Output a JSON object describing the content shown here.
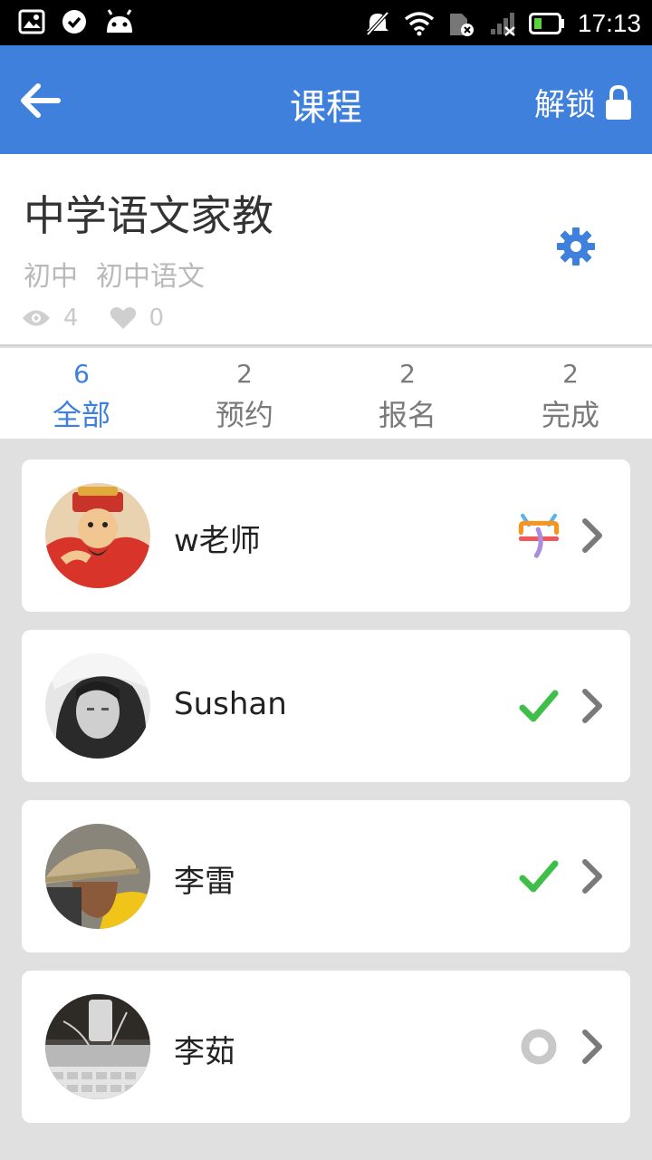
{
  "status_bar": {
    "time": "17:13"
  },
  "app_bar": {
    "title": "课程",
    "unlock_label": "解锁"
  },
  "course": {
    "title": "中学语文家教",
    "tags": [
      "初中",
      "初中语文"
    ],
    "views": "4",
    "likes": "0"
  },
  "tabs": [
    {
      "count": "6",
      "label": "全部"
    },
    {
      "count": "2",
      "label": "预约"
    },
    {
      "count": "2",
      "label": "报名"
    },
    {
      "count": "2",
      "label": "完成"
    }
  ],
  "students": [
    {
      "name": "w老师",
      "status": "studying"
    },
    {
      "name": "Sushan",
      "status": "completed"
    },
    {
      "name": "李雷",
      "status": "completed"
    },
    {
      "name": "李茹",
      "status": "pending"
    }
  ],
  "colors": {
    "accent": "#3e80dc",
    "check": "#3fbe4a",
    "pending": "#c8c8c8"
  }
}
